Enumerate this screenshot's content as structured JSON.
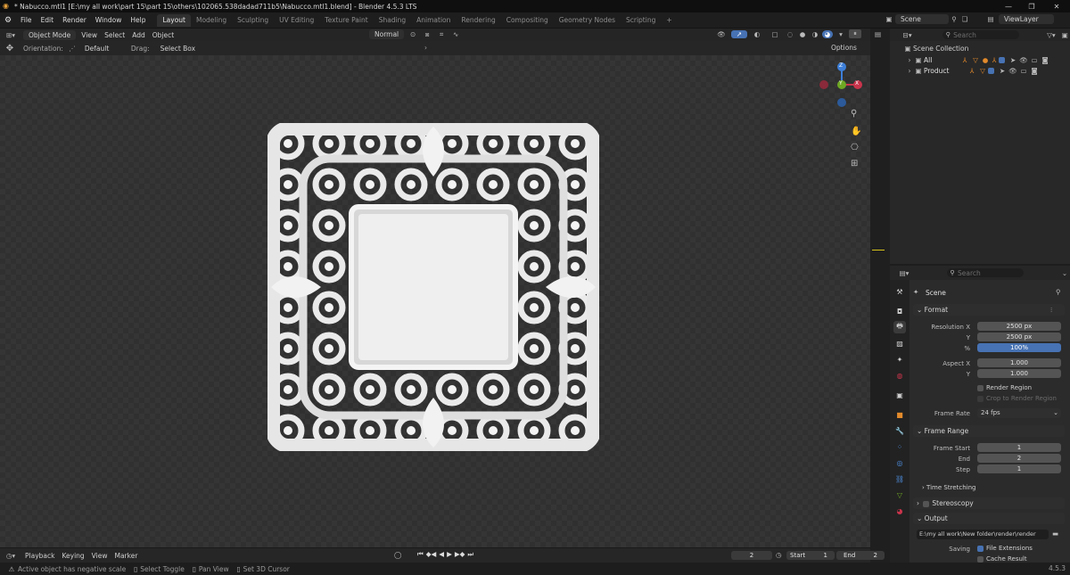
{
  "window": {
    "title": "* Nabucco.mtl1 [E:\\my all work\\part 15\\part 15\\others\\102065.538dadad711b5\\Nabucco.mtl1.blend] - Blender 4.5.3 LTS"
  },
  "menus": [
    "File",
    "Edit",
    "Render",
    "Window",
    "Help"
  ],
  "workspaces": [
    "Layout",
    "Modeling",
    "Sculpting",
    "UV Editing",
    "Texture Paint",
    "Shading",
    "Animation",
    "Rendering",
    "Compositing",
    "Geometry Nodes",
    "Scripting"
  ],
  "active_workspace": "Layout",
  "topright": {
    "scene": "Scene",
    "viewlayer": "ViewLayer"
  },
  "viewport_header": {
    "mode": "Object Mode",
    "menus": [
      "View",
      "Select",
      "Add",
      "Object"
    ],
    "orientation_transform": "Normal"
  },
  "tool_header": {
    "orientation_label": "Orientation:",
    "orientation_value": "Default",
    "drag_label": "Drag:",
    "drag_value": "Select Box",
    "options": "Options"
  },
  "gizmo": {
    "x": "X",
    "y": "Y",
    "z": "Z"
  },
  "outliner": {
    "search_placeholder": "Search",
    "root": "Scene Collection",
    "collections": [
      {
        "name": "All"
      },
      {
        "name": "Product"
      }
    ]
  },
  "properties": {
    "search_placeholder": "Search",
    "scene_name": "Scene",
    "format": {
      "title": "Format",
      "res_x_label": "Resolution X",
      "res_x": "2500 px",
      "res_y_label": "Y",
      "res_y": "2500 px",
      "pct_label": "%",
      "pct": "100%",
      "aspect_x_label": "Aspect X",
      "aspect_x": "1.000",
      "aspect_y_label": "Y",
      "aspect_y": "1.000",
      "render_region": "Render Region",
      "crop": "Crop to Render Region",
      "frame_rate_label": "Frame Rate",
      "frame_rate": "24 fps"
    },
    "frame_range": {
      "title": "Frame Range",
      "start_label": "Frame Start",
      "start": "1",
      "end_label": "End",
      "end": "2",
      "step_label": "Step",
      "step": "1"
    },
    "time_stretching": "Time Stretching",
    "stereoscopy": "Stereoscopy",
    "output": {
      "title": "Output",
      "path": "E:\\my all work\\New folder\\render\\render",
      "saving_label": "Saving",
      "file_ext": "File Extensions",
      "cache": "Cache Result"
    }
  },
  "timeline": {
    "menus": [
      "Playback",
      "Keying",
      "View",
      "Marker"
    ],
    "current": "2",
    "start_label": "Start",
    "start": "1",
    "end_label": "End",
    "end": "2"
  },
  "status": {
    "warning": "Active object has negative scale",
    "select": "Select Toggle",
    "pan": "Pan View",
    "cursor": "Set 3D Cursor",
    "version": "4.5.3"
  },
  "colors": {
    "accent": "#4772b3",
    "x_axis": "#c9344b",
    "y_axis": "#6ea823",
    "z_axis": "#3d7fd9"
  }
}
